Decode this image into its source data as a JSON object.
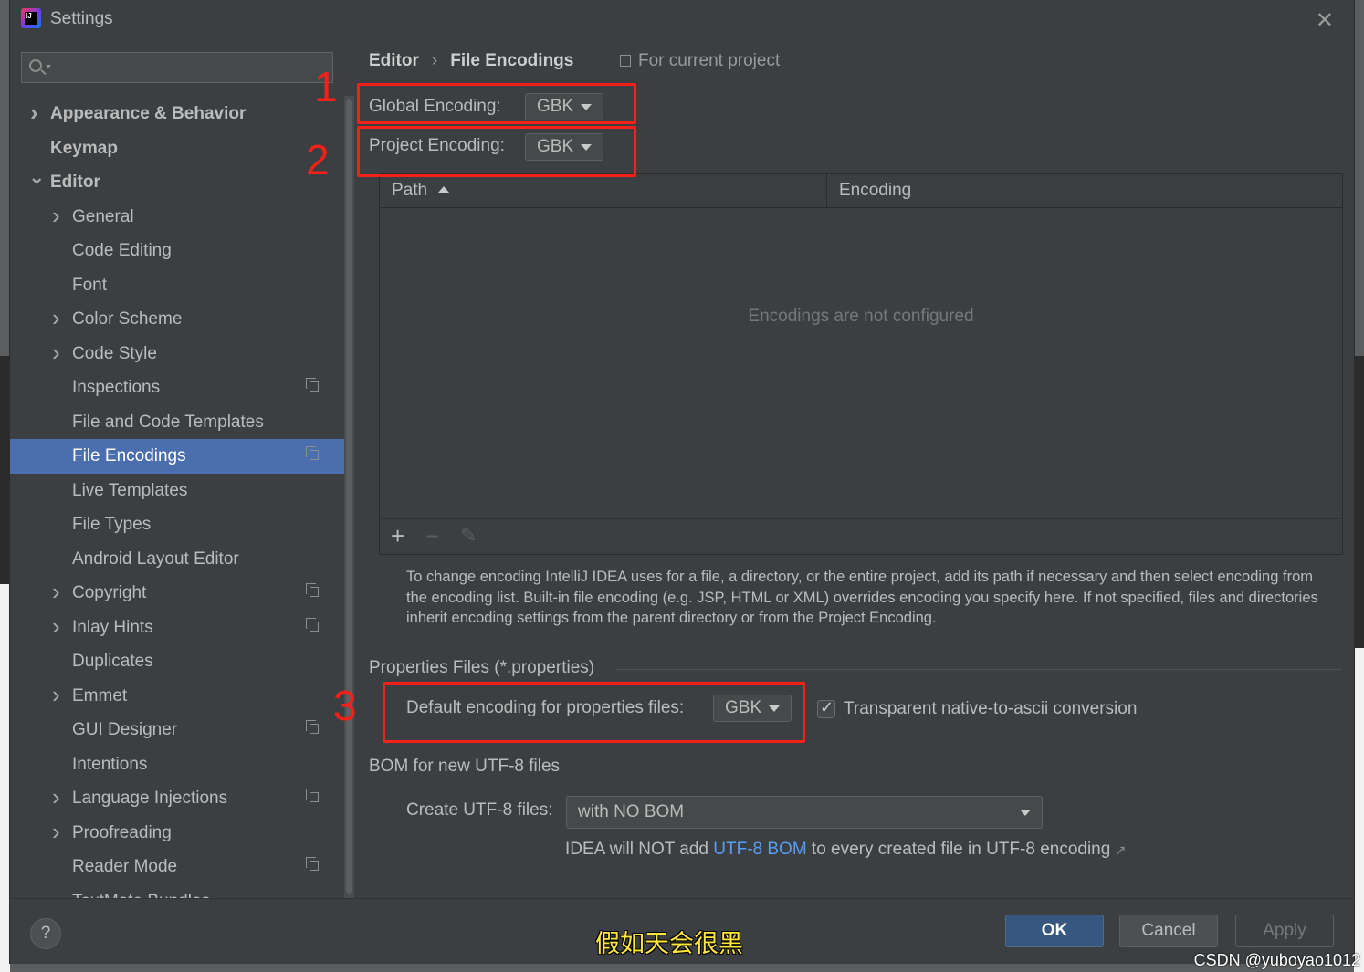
{
  "window": {
    "title": "Settings",
    "icon_text": "IJ"
  },
  "sidebar": {
    "search_placeholder": "",
    "items": [
      {
        "label": "Appearance & Behavior"
      },
      {
        "label": "Keymap"
      },
      {
        "label": "Editor"
      },
      {
        "label": "General"
      },
      {
        "label": "Code Editing"
      },
      {
        "label": "Font"
      },
      {
        "label": "Color Scheme"
      },
      {
        "label": "Code Style"
      },
      {
        "label": "Inspections"
      },
      {
        "label": "File and Code Templates"
      },
      {
        "label": "File Encodings"
      },
      {
        "label": "Live Templates"
      },
      {
        "label": "File Types"
      },
      {
        "label": "Android Layout Editor"
      },
      {
        "label": "Copyright"
      },
      {
        "label": "Inlay Hints"
      },
      {
        "label": "Duplicates"
      },
      {
        "label": "Emmet"
      },
      {
        "label": "GUI Designer"
      },
      {
        "label": "Intentions"
      },
      {
        "label": "Language Injections"
      },
      {
        "label": "Proofreading"
      },
      {
        "label": "Reader Mode"
      },
      {
        "label": "TextMate Bundles"
      }
    ]
  },
  "main": {
    "breadcrumb": [
      "Editor",
      "File Encodings"
    ],
    "scope_label": "For current project",
    "global_encoding": {
      "label": "Global Encoding:",
      "value": "GBK"
    },
    "project_encoding": {
      "label": "Project Encoding:",
      "value": "GBK"
    },
    "table": {
      "columns": [
        "Path",
        "Encoding"
      ],
      "empty_text": "Encodings are not configured",
      "toolbar": {
        "add": "+",
        "remove": "−",
        "edit": "✎"
      }
    },
    "help_text": "To change encoding IntelliJ IDEA uses for a file, a directory, or the entire project, add its path if necessary and then select encoding from the encoding list. Built-in file encoding (e.g. JSP, HTML or XML) overrides encoding you specify here. If not specified, files and directories inherit encoding settings from the parent directory or from the Project Encoding.",
    "properties_section": {
      "title": "Properties Files (*.properties)",
      "default_label": "Default encoding for properties files:",
      "default_value": "GBK",
      "transparent_label": "Transparent native-to-ascii conversion",
      "transparent_checked": true
    },
    "bom_section": {
      "title": "BOM for new UTF-8 files",
      "create_label": "Create UTF-8 files:",
      "create_value": "with NO BOM",
      "note_prefix": "IDEA will NOT add ",
      "note_link": "UTF-8 BOM",
      "note_suffix": " to every created file in UTF-8 encoding",
      "note_arrow": "↗"
    }
  },
  "annotations": [
    "1",
    "2",
    "3"
  ],
  "annotation_color": "#f4201a",
  "footer": {
    "help": "?",
    "ok": "OK",
    "cancel": "Cancel",
    "apply": "Apply"
  },
  "overlay": {
    "subtitle": "假如天会很黑",
    "watermark": "CSDN @yuboyao1012"
  }
}
